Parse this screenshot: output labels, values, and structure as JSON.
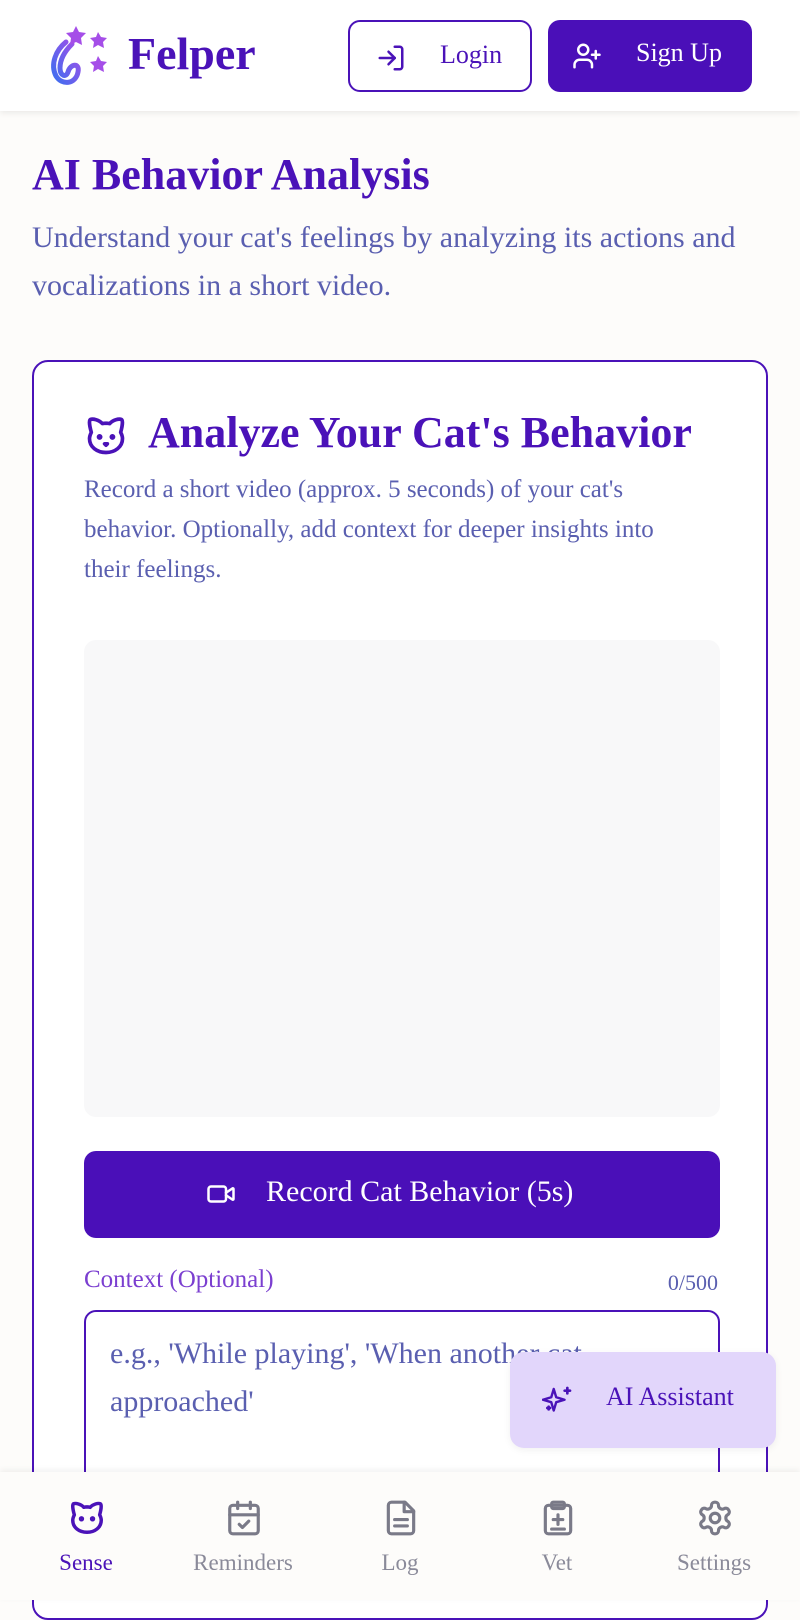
{
  "header": {
    "brand": "Felper",
    "login_label": "Login",
    "signup_label": "Sign Up"
  },
  "page": {
    "title": "AI Behavior Analysis",
    "subtitle": "Understand your cat's feelings by analyzing its actions and vocalizations in a short video."
  },
  "card": {
    "title": "Analyze Your Cat's Behavior",
    "description": "Record a short video (approx. 5 seconds) of your cat's behavior. Optionally, add context for deeper insights into their feelings.",
    "record_label": "Record Cat Behavior (5s)",
    "context_label": "Context (Optional)",
    "context_count": "0/500",
    "context_value": "",
    "context_placeholder": "e.g., 'While playing', 'When another cat approached'"
  },
  "ai_assistant": {
    "label": "AI Assistant"
  },
  "nav": {
    "items": [
      {
        "label": "Sense",
        "icon": "cat-icon",
        "active": true
      },
      {
        "label": "Reminders",
        "icon": "calendar-check-icon",
        "active": false
      },
      {
        "label": "Log",
        "icon": "document-icon",
        "active": false
      },
      {
        "label": "Vet",
        "icon": "medical-clipboard-icon",
        "active": false
      },
      {
        "label": "Settings",
        "icon": "gear-icon",
        "active": false
      }
    ]
  },
  "colors": {
    "primary": "#4a0fb8",
    "text_secondary": "#5a5fb0",
    "accent_purple": "#7b3fd0",
    "fab_bg": "#e2d6fb",
    "inactive_gray": "#8a8a99"
  }
}
